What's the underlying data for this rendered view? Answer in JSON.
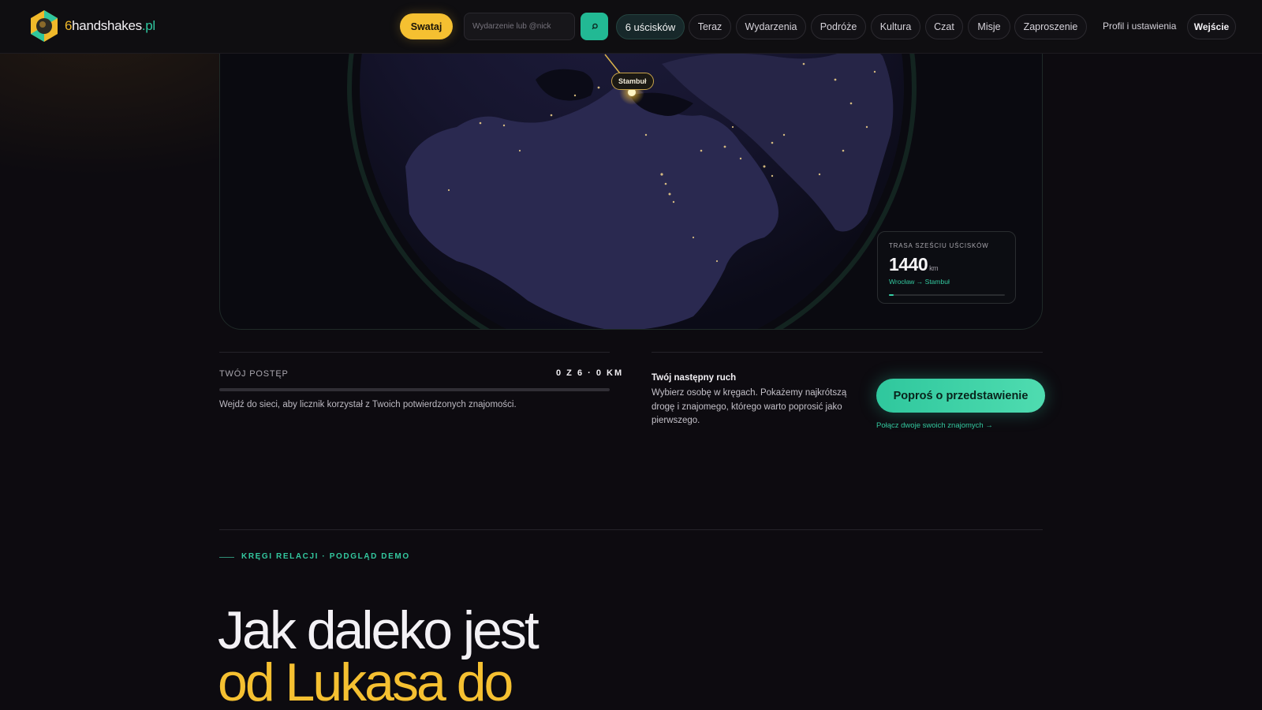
{
  "header": {
    "logo": {
      "prefix": "6",
      "name": "handshakes",
      "tld": ".pl"
    },
    "swataj_label": "Swataj",
    "search": {
      "placeholder": "Wydarzenie lub @nick",
      "value": ""
    },
    "search_button_icon": "search-icon",
    "nav": [
      {
        "label": "6 uścisków",
        "active": true
      },
      {
        "label": "Teraz",
        "active": false
      },
      {
        "label": "Wydarzenia",
        "active": false
      },
      {
        "label": "Podróże",
        "active": false
      },
      {
        "label": "Kultura",
        "active": false
      },
      {
        "label": "Czat",
        "active": false
      },
      {
        "label": "Misje",
        "active": false
      },
      {
        "label": "Zaproszenie",
        "active": false
      }
    ],
    "profile_label": "Profil i ustawienia",
    "login_label": "Wejście"
  },
  "map": {
    "pin_label": "Stambuł",
    "stat": {
      "label": "TRASA SZEŚCIU UŚCISKÓW",
      "value": "1440",
      "unit": "km",
      "route": "Wrocław → Stambuł",
      "progress_fraction": 0.04
    }
  },
  "progress": {
    "title": "TWÓJ POSTĘP",
    "count": "0 Z 6 · 0 KM",
    "fraction": 0,
    "note": "Wejdź do sieci, aby licznik korzystał z Twoich potwierdzonych znajomości."
  },
  "next_move": {
    "title": "Twój następny ruch",
    "text": "Wybierz osobę w kręgach. Pokażemy najkrótszą drogę i znajomego, którego warto poprosić jako pierwszego.",
    "button_label": "Poproś o przedstawienie",
    "link_label": "Połącz dwoje swoich znajomych →"
  },
  "circles": {
    "eyebrow": "KRĘGI RELACJI · PODGLĄD DEMO",
    "headline_line1": "Jak daleko jest",
    "headline_line2": "od Lukasa do"
  },
  "colors": {
    "accent_green": "#2fc79d",
    "accent_yellow": "#f5c031",
    "background": "#0d0b10"
  }
}
